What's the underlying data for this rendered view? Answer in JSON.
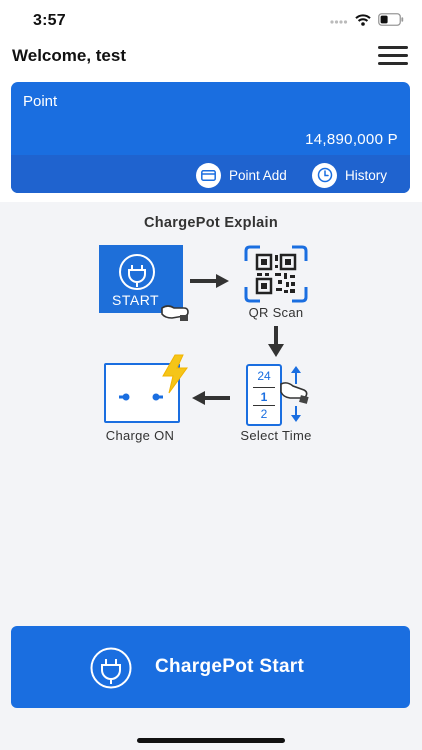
{
  "status_bar": {
    "time": "3:57"
  },
  "header": {
    "welcome": "Welcome, test"
  },
  "point_card": {
    "label": "Point",
    "value": "14,890,000 P",
    "point_add_label": "Point Add",
    "history_label": "History"
  },
  "explain": {
    "title": "ChargePot Explain",
    "start_text": "START",
    "qr_caption": "QR Scan",
    "time_top": "24",
    "time_mid": "1",
    "time_bottom": "2",
    "time_caption": "Select Time",
    "charge_caption": "Charge ON"
  },
  "cta": {
    "label": "ChargePot Start"
  },
  "colors": {
    "primary": "#1a6ee0",
    "primary_dark": "#1f63cf",
    "bolt": "#f5c518"
  }
}
